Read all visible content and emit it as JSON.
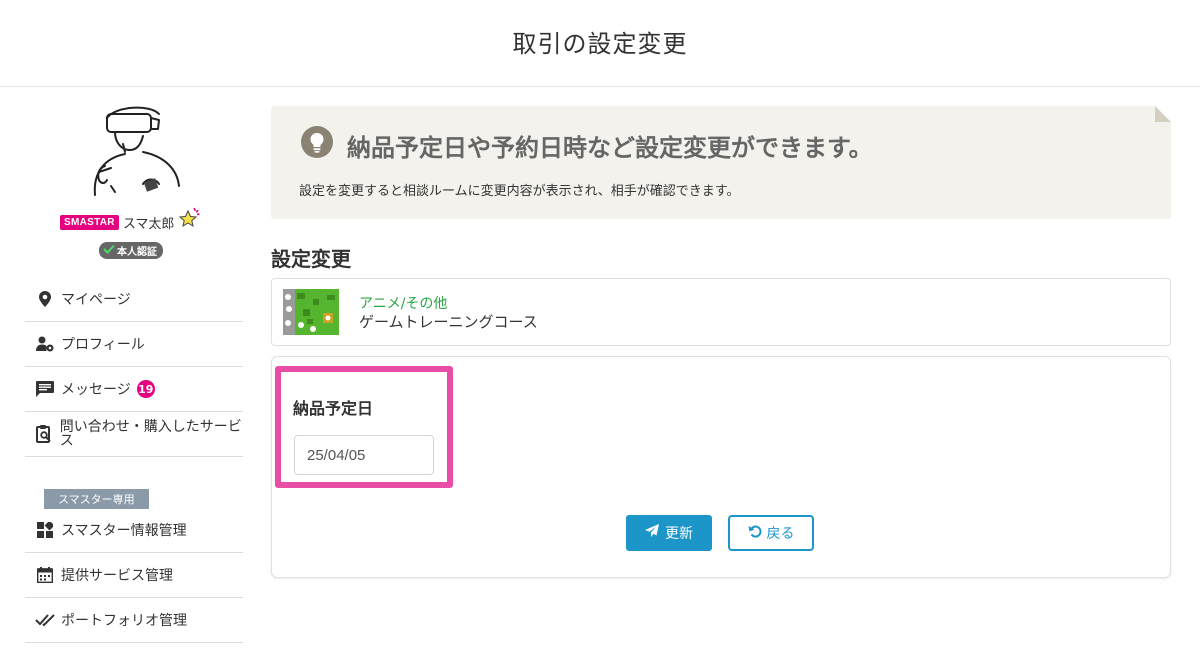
{
  "header": {
    "title": "取引の設定変更"
  },
  "user": {
    "badge": "SMASTAR",
    "name": "スマ太郎",
    "verified_label": "本人認証"
  },
  "sidebar": {
    "items": [
      {
        "label": "マイページ",
        "icon": "map-pin-icon"
      },
      {
        "label": "プロフィール",
        "icon": "user-gear-icon"
      },
      {
        "label": "メッセージ",
        "icon": "message-icon",
        "badge": "19"
      },
      {
        "label": "問い合わせ・購入したサービス",
        "icon": "clipboard-search-icon"
      }
    ],
    "section_tag": "スマスター専用",
    "smastar_items": [
      {
        "label": "スマスター情報管理",
        "icon": "dashboard-icon"
      },
      {
        "label": "提供サービス管理",
        "icon": "calendar-icon"
      },
      {
        "label": "ポートフォリオ管理",
        "icon": "double-check-icon"
      }
    ]
  },
  "info": {
    "title": "納品予定日や予約日時など設定変更ができます。",
    "text": "設定を変更すると相談ルームに変更内容が表示され、相手が確認できます。"
  },
  "section": {
    "heading": "設定変更"
  },
  "service": {
    "category": "アニメ/その他",
    "name": "ゲームトレーニングコース"
  },
  "form": {
    "field_label": "納品予定日",
    "date_value": "25/04/05",
    "update_label": "更新",
    "back_label": "戻る"
  },
  "colors": {
    "brand_pink": "#e4007f",
    "highlight": "#e94ea6",
    "primary_blue": "#1c96c9",
    "category_green": "#28a745",
    "info_bg": "#f3f2ed"
  }
}
